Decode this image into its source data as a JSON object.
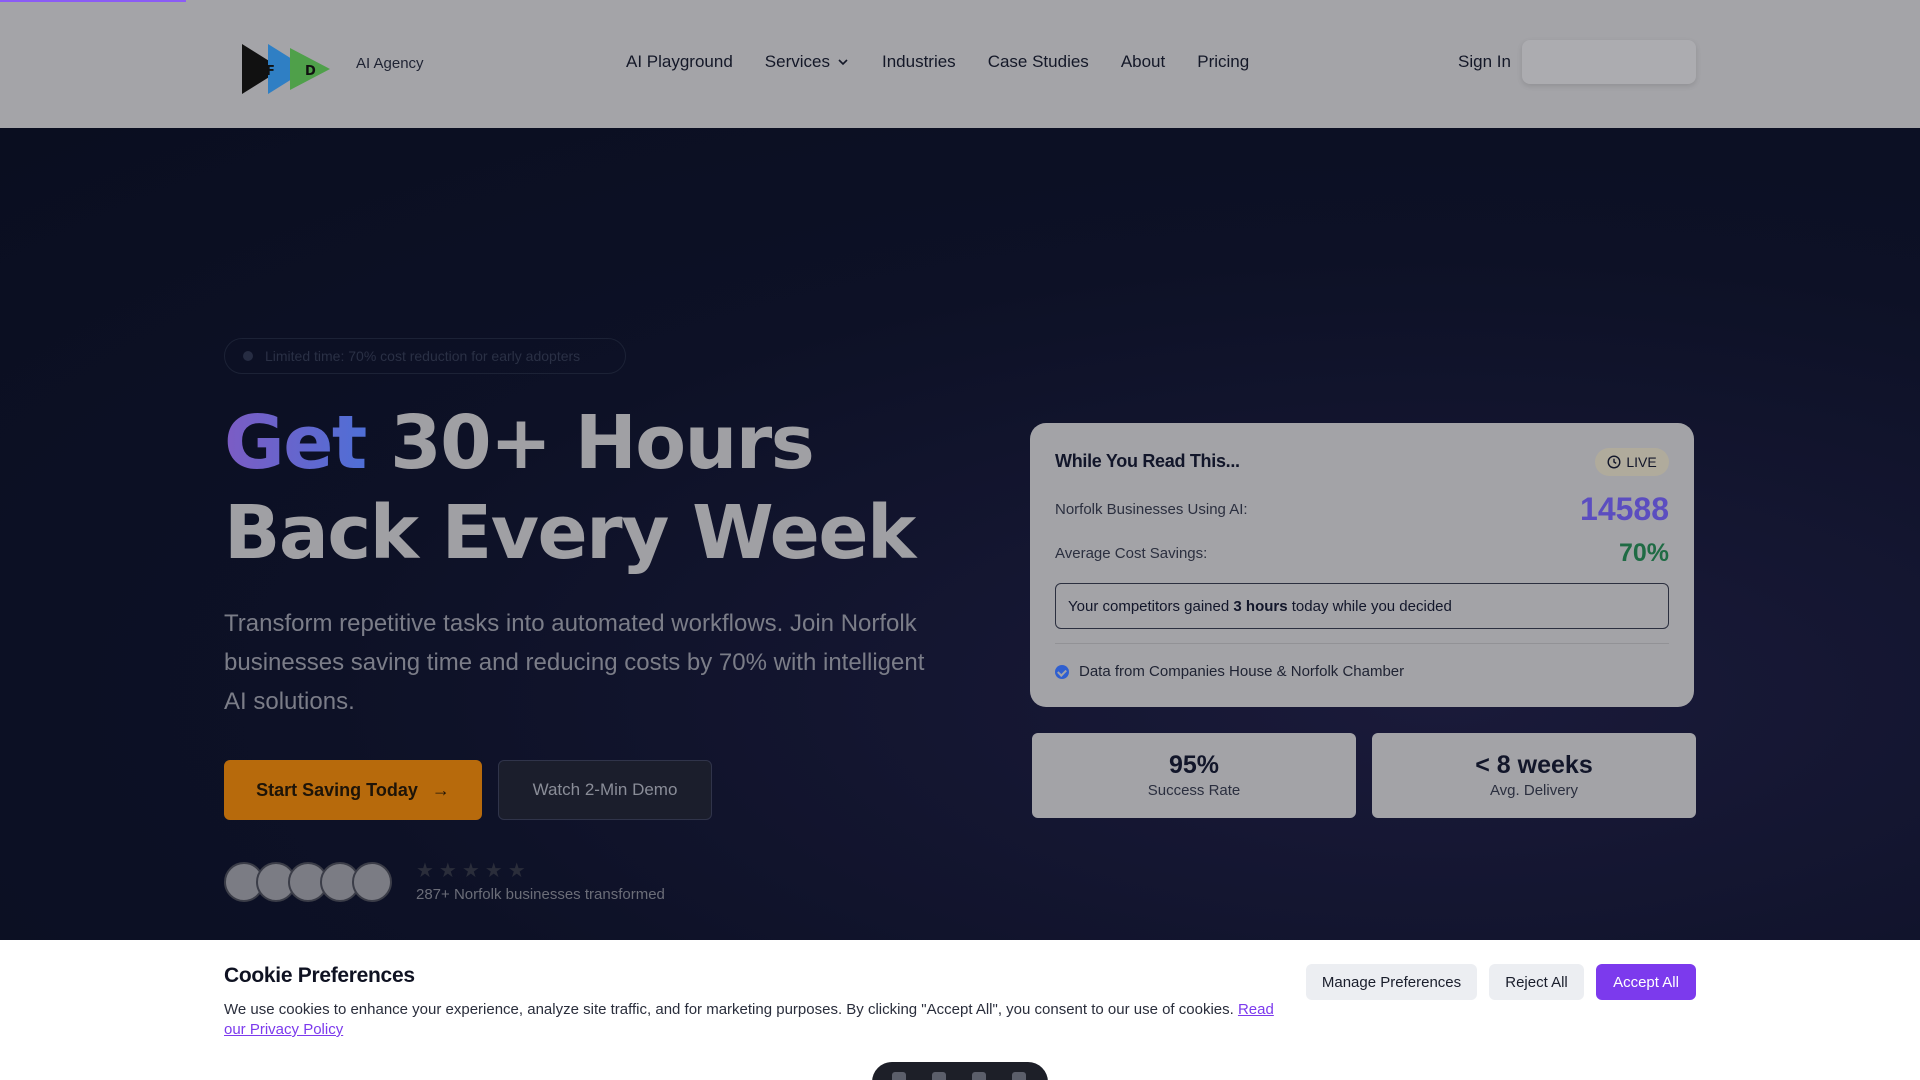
{
  "header": {
    "logo_text": "AI Agency",
    "logo_letters": [
      "F",
      "D"
    ],
    "nav": [
      {
        "label": "AI Playground"
      },
      {
        "label": "Services"
      },
      {
        "label": "Industries"
      },
      {
        "label": "Case Studies"
      },
      {
        "label": "About"
      },
      {
        "label": "Pricing"
      }
    ],
    "sign_in": "Sign In"
  },
  "hero": {
    "badge": "Limited time: 70% cost reduction for early adopters",
    "headline_accent": "Get",
    "headline_rest": " 30+ Hours Back Every Week",
    "subtext": "Transform repetitive tasks into automated workflows. Join Norfolk businesses saving time and reducing costs by 70% with intelligent AI solutions.",
    "primary_cta": "Start Saving Today",
    "secondary_cta": "Watch 2-Min Demo",
    "stars": "★★★★★",
    "social_proof": "287+ Norfolk businesses transformed"
  },
  "live_card": {
    "title": "While You Read This...",
    "badge": "LIVE",
    "metrics": [
      {
        "label": "Norfolk Businesses Using AI:",
        "value": "14588"
      },
      {
        "label": "Average Cost Savings:",
        "value": "70%"
      }
    ],
    "competitor_prefix": "Your competitors gained ",
    "competitor_bold": "3 hours",
    "competitor_suffix": " today while you decided",
    "source": "Data from Companies House & Norfolk Chamber"
  },
  "stats": [
    {
      "value": "95%",
      "label": "Success Rate"
    },
    {
      "value": "< 8 weeks",
      "label": "Avg. Delivery"
    }
  ],
  "cookie": {
    "title": "Cookie Preferences",
    "text": "We use cookies to enhance your experience, analyze site traffic, and for marketing purposes. By clicking \"Accept All\", you consent to our use of cookies. ",
    "link": "Read our Privacy Policy",
    "manage": "Manage Preferences",
    "reject": "Reject All",
    "accept": "Accept All"
  },
  "colors": {
    "accent_purple": "#7c3aed",
    "cta_orange": "#b76a0c",
    "metric_purple": "#5b4dc0",
    "metric_green": "#1f6b44"
  }
}
